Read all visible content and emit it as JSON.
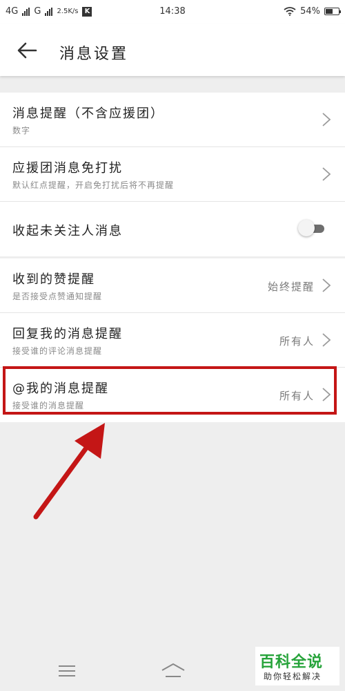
{
  "status_bar": {
    "network1": "4G",
    "network2": "G",
    "speed": "2.5K/s",
    "app_badge": "K",
    "time": "14:38",
    "battery": "54%",
    "battery_level": 0.54
  },
  "header": {
    "title": "消息设置",
    "back_icon": "arrow-left-icon"
  },
  "group1": [
    {
      "title": "消息提醒（不含应援团）",
      "subtitle": "数字",
      "control": "chevron"
    },
    {
      "title": "应援团消息免打扰",
      "subtitle": "默认红点提醒，开启免打扰后将不再提醒",
      "control": "chevron"
    },
    {
      "title": "收起未关注人消息",
      "control": "toggle",
      "toggle_on": false
    }
  ],
  "group2": [
    {
      "title": "收到的赞提醒",
      "subtitle": "是否接受点赞通知提醒",
      "value": "始终提醒",
      "control": "chevron"
    },
    {
      "title": "回复我的消息提醒",
      "subtitle": "接受谁的评论消息提醒",
      "value": "所有人",
      "control": "chevron"
    },
    {
      "title": "@我的消息提醒",
      "subtitle": "接受谁的消息提醒",
      "value": "所有人",
      "control": "chevron",
      "highlighted": true
    }
  ],
  "annotation": {
    "color": "#c41616"
  },
  "nav": {
    "menu_icon": "menu-icon",
    "home_icon": "home-icon"
  },
  "watermark": {
    "main": "百科全说",
    "sub": "助你轻松解决",
    "color": "#26a33a"
  }
}
